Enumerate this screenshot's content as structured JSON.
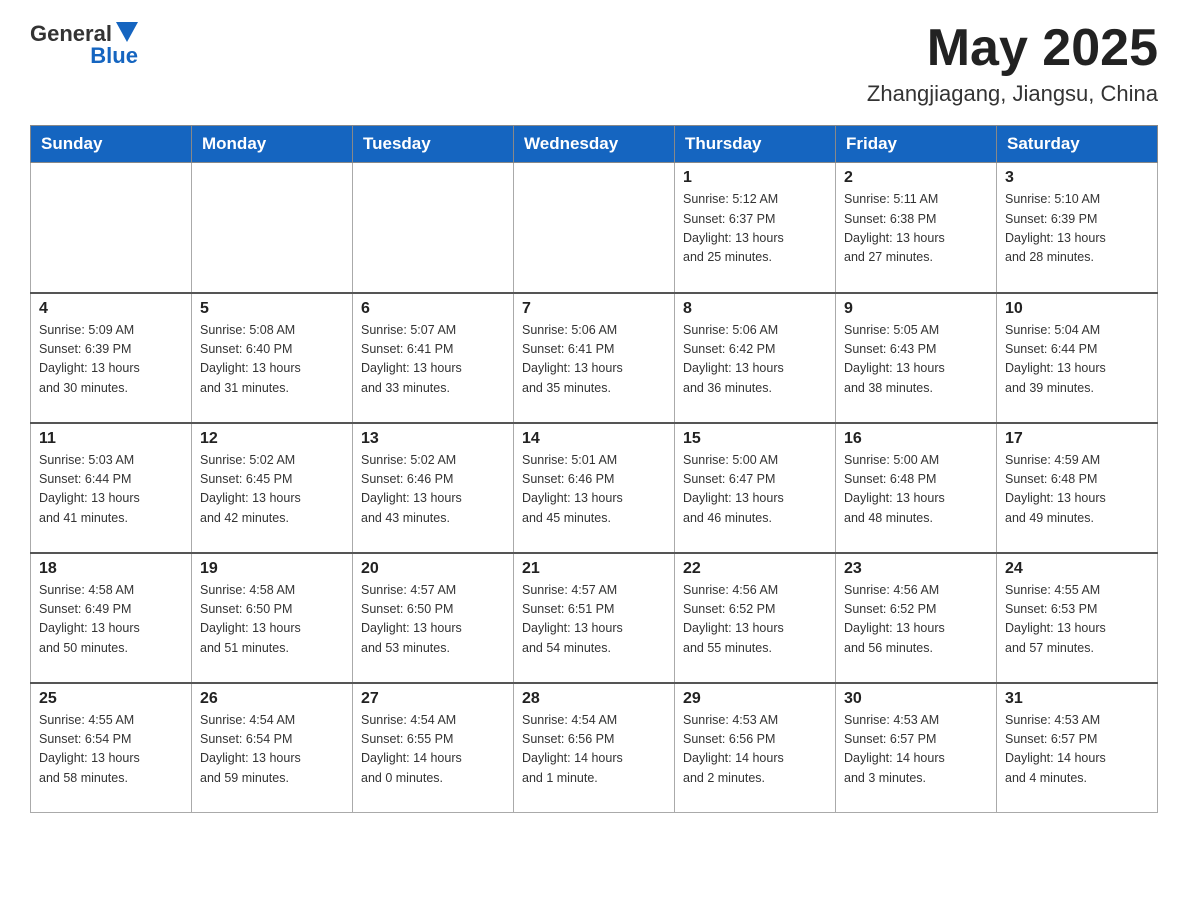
{
  "header": {
    "logo_general": "General",
    "logo_blue": "Blue",
    "title": "May 2025",
    "subtitle": "Zhangjiagang, Jiangsu, China"
  },
  "days_of_week": [
    "Sunday",
    "Monday",
    "Tuesday",
    "Wednesday",
    "Thursday",
    "Friday",
    "Saturday"
  ],
  "weeks": [
    [
      {
        "num": "",
        "info": ""
      },
      {
        "num": "",
        "info": ""
      },
      {
        "num": "",
        "info": ""
      },
      {
        "num": "",
        "info": ""
      },
      {
        "num": "1",
        "info": "Sunrise: 5:12 AM\nSunset: 6:37 PM\nDaylight: 13 hours\nand 25 minutes."
      },
      {
        "num": "2",
        "info": "Sunrise: 5:11 AM\nSunset: 6:38 PM\nDaylight: 13 hours\nand 27 minutes."
      },
      {
        "num": "3",
        "info": "Sunrise: 5:10 AM\nSunset: 6:39 PM\nDaylight: 13 hours\nand 28 minutes."
      }
    ],
    [
      {
        "num": "4",
        "info": "Sunrise: 5:09 AM\nSunset: 6:39 PM\nDaylight: 13 hours\nand 30 minutes."
      },
      {
        "num": "5",
        "info": "Sunrise: 5:08 AM\nSunset: 6:40 PM\nDaylight: 13 hours\nand 31 minutes."
      },
      {
        "num": "6",
        "info": "Sunrise: 5:07 AM\nSunset: 6:41 PM\nDaylight: 13 hours\nand 33 minutes."
      },
      {
        "num": "7",
        "info": "Sunrise: 5:06 AM\nSunset: 6:41 PM\nDaylight: 13 hours\nand 35 minutes."
      },
      {
        "num": "8",
        "info": "Sunrise: 5:06 AM\nSunset: 6:42 PM\nDaylight: 13 hours\nand 36 minutes."
      },
      {
        "num": "9",
        "info": "Sunrise: 5:05 AM\nSunset: 6:43 PM\nDaylight: 13 hours\nand 38 minutes."
      },
      {
        "num": "10",
        "info": "Sunrise: 5:04 AM\nSunset: 6:44 PM\nDaylight: 13 hours\nand 39 minutes."
      }
    ],
    [
      {
        "num": "11",
        "info": "Sunrise: 5:03 AM\nSunset: 6:44 PM\nDaylight: 13 hours\nand 41 minutes."
      },
      {
        "num": "12",
        "info": "Sunrise: 5:02 AM\nSunset: 6:45 PM\nDaylight: 13 hours\nand 42 minutes."
      },
      {
        "num": "13",
        "info": "Sunrise: 5:02 AM\nSunset: 6:46 PM\nDaylight: 13 hours\nand 43 minutes."
      },
      {
        "num": "14",
        "info": "Sunrise: 5:01 AM\nSunset: 6:46 PM\nDaylight: 13 hours\nand 45 minutes."
      },
      {
        "num": "15",
        "info": "Sunrise: 5:00 AM\nSunset: 6:47 PM\nDaylight: 13 hours\nand 46 minutes."
      },
      {
        "num": "16",
        "info": "Sunrise: 5:00 AM\nSunset: 6:48 PM\nDaylight: 13 hours\nand 48 minutes."
      },
      {
        "num": "17",
        "info": "Sunrise: 4:59 AM\nSunset: 6:48 PM\nDaylight: 13 hours\nand 49 minutes."
      }
    ],
    [
      {
        "num": "18",
        "info": "Sunrise: 4:58 AM\nSunset: 6:49 PM\nDaylight: 13 hours\nand 50 minutes."
      },
      {
        "num": "19",
        "info": "Sunrise: 4:58 AM\nSunset: 6:50 PM\nDaylight: 13 hours\nand 51 minutes."
      },
      {
        "num": "20",
        "info": "Sunrise: 4:57 AM\nSunset: 6:50 PM\nDaylight: 13 hours\nand 53 minutes."
      },
      {
        "num": "21",
        "info": "Sunrise: 4:57 AM\nSunset: 6:51 PM\nDaylight: 13 hours\nand 54 minutes."
      },
      {
        "num": "22",
        "info": "Sunrise: 4:56 AM\nSunset: 6:52 PM\nDaylight: 13 hours\nand 55 minutes."
      },
      {
        "num": "23",
        "info": "Sunrise: 4:56 AM\nSunset: 6:52 PM\nDaylight: 13 hours\nand 56 minutes."
      },
      {
        "num": "24",
        "info": "Sunrise: 4:55 AM\nSunset: 6:53 PM\nDaylight: 13 hours\nand 57 minutes."
      }
    ],
    [
      {
        "num": "25",
        "info": "Sunrise: 4:55 AM\nSunset: 6:54 PM\nDaylight: 13 hours\nand 58 minutes."
      },
      {
        "num": "26",
        "info": "Sunrise: 4:54 AM\nSunset: 6:54 PM\nDaylight: 13 hours\nand 59 minutes."
      },
      {
        "num": "27",
        "info": "Sunrise: 4:54 AM\nSunset: 6:55 PM\nDaylight: 14 hours\nand 0 minutes."
      },
      {
        "num": "28",
        "info": "Sunrise: 4:54 AM\nSunset: 6:56 PM\nDaylight: 14 hours\nand 1 minute."
      },
      {
        "num": "29",
        "info": "Sunrise: 4:53 AM\nSunset: 6:56 PM\nDaylight: 14 hours\nand 2 minutes."
      },
      {
        "num": "30",
        "info": "Sunrise: 4:53 AM\nSunset: 6:57 PM\nDaylight: 14 hours\nand 3 minutes."
      },
      {
        "num": "31",
        "info": "Sunrise: 4:53 AM\nSunset: 6:57 PM\nDaylight: 14 hours\nand 4 minutes."
      }
    ]
  ]
}
